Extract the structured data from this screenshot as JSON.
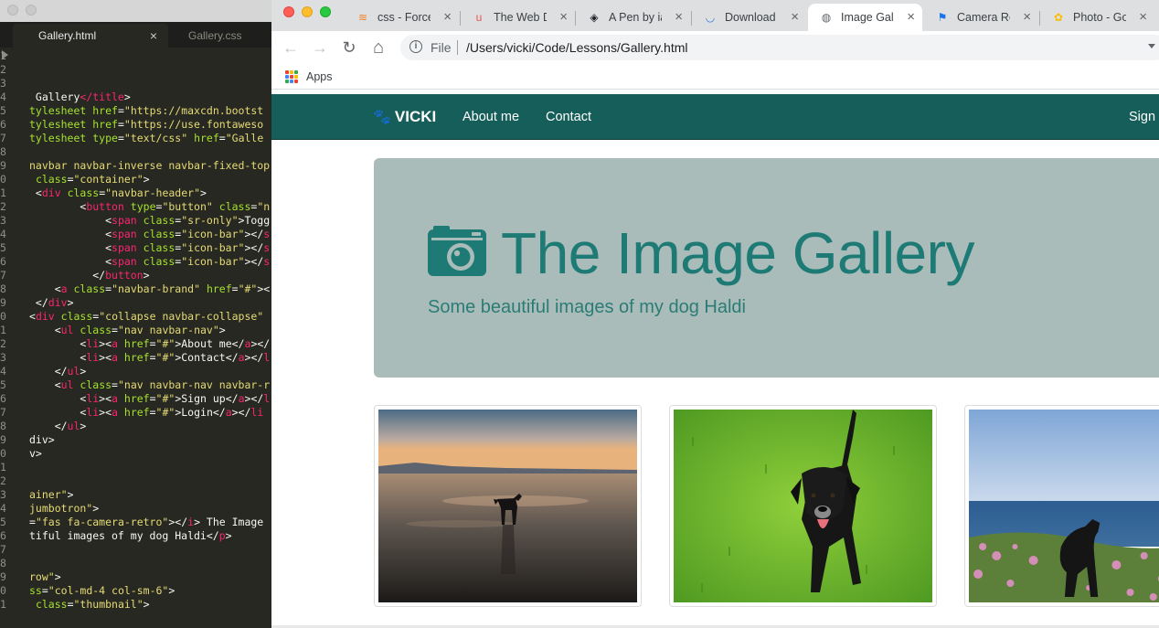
{
  "editor": {
    "tabs": [
      {
        "label": "Gallery.html",
        "active": true
      },
      {
        "label": "Gallery.css",
        "active": false
      }
    ],
    "close_glyph": "×",
    "lines": [
      {
        "n": "1",
        "parts": []
      },
      {
        "n": "2",
        "parts": []
      },
      {
        "n": "3",
        "parts": []
      },
      {
        "n": "4",
        "parts": [
          [
            "w",
            " Gallery"
          ],
          [
            "t",
            "</title"
          ],
          [
            "w",
            ">"
          ]
        ]
      },
      {
        "n": "5",
        "parts": [
          [
            "a",
            "tylesheet"
          ],
          [
            "w",
            " "
          ],
          [
            "a",
            "href"
          ],
          [
            "w",
            "="
          ],
          [
            "s",
            "\"https://maxcdn.bootst"
          ]
        ]
      },
      {
        "n": "6",
        "parts": [
          [
            "a",
            "tylesheet"
          ],
          [
            "w",
            " "
          ],
          [
            "a",
            "href"
          ],
          [
            "w",
            "="
          ],
          [
            "s",
            "\"https://use.fontaweso"
          ]
        ]
      },
      {
        "n": "7",
        "parts": [
          [
            "a",
            "tylesheet"
          ],
          [
            "w",
            " "
          ],
          [
            "a",
            "type"
          ],
          [
            "w",
            "="
          ],
          [
            "s",
            "\"text/css\""
          ],
          [
            "w",
            " "
          ],
          [
            "a",
            "href"
          ],
          [
            "w",
            "="
          ],
          [
            "s",
            "\"Galle"
          ]
        ]
      },
      {
        "n": "8",
        "parts": []
      },
      {
        "n": "9",
        "parts": [
          [
            "s",
            "navbar navbar-inverse navbar-fixed-top"
          ]
        ]
      },
      {
        "n": "0",
        "parts": [
          [
            "w",
            " "
          ],
          [
            "a",
            "class"
          ],
          [
            "w",
            "="
          ],
          [
            "s",
            "\"container\""
          ],
          [
            "w",
            ">"
          ]
        ]
      },
      {
        "n": "1",
        "parts": [
          [
            "w",
            " <"
          ],
          [
            "t",
            "div"
          ],
          [
            "w",
            " "
          ],
          [
            "a",
            "class"
          ],
          [
            "w",
            "="
          ],
          [
            "s",
            "\"navbar-header\""
          ],
          [
            "w",
            ">"
          ]
        ]
      },
      {
        "n": "2",
        "parts": [
          [
            "w",
            "        <"
          ],
          [
            "t",
            "button"
          ],
          [
            "w",
            " "
          ],
          [
            "a",
            "type"
          ],
          [
            "w",
            "="
          ],
          [
            "s",
            "\"button\""
          ],
          [
            "w",
            " "
          ],
          [
            "a",
            "class"
          ],
          [
            "w",
            "="
          ],
          [
            "s",
            "\"n"
          ]
        ]
      },
      {
        "n": "3",
        "parts": [
          [
            "w",
            "            <"
          ],
          [
            "t",
            "span"
          ],
          [
            "w",
            " "
          ],
          [
            "a",
            "class"
          ],
          [
            "w",
            "="
          ],
          [
            "s",
            "\"sr-only\""
          ],
          [
            "w",
            ">Togg"
          ]
        ]
      },
      {
        "n": "4",
        "parts": [
          [
            "w",
            "            <"
          ],
          [
            "t",
            "span"
          ],
          [
            "w",
            " "
          ],
          [
            "a",
            "class"
          ],
          [
            "w",
            "="
          ],
          [
            "s",
            "\"icon-bar\""
          ],
          [
            "w",
            "></"
          ],
          [
            "t",
            "s"
          ]
        ]
      },
      {
        "n": "5",
        "parts": [
          [
            "w",
            "            <"
          ],
          [
            "t",
            "span"
          ],
          [
            "w",
            " "
          ],
          [
            "a",
            "class"
          ],
          [
            "w",
            "="
          ],
          [
            "s",
            "\"icon-bar\""
          ],
          [
            "w",
            "></"
          ],
          [
            "t",
            "s"
          ]
        ]
      },
      {
        "n": "6",
        "parts": [
          [
            "w",
            "            <"
          ],
          [
            "t",
            "span"
          ],
          [
            "w",
            " "
          ],
          [
            "a",
            "class"
          ],
          [
            "w",
            "="
          ],
          [
            "s",
            "\"icon-bar\""
          ],
          [
            "w",
            "></"
          ],
          [
            "t",
            "s"
          ]
        ]
      },
      {
        "n": "7",
        "parts": [
          [
            "w",
            "          </"
          ],
          [
            "t",
            "button"
          ],
          [
            "w",
            ">"
          ]
        ]
      },
      {
        "n": "8",
        "parts": [
          [
            "w",
            "    <"
          ],
          [
            "t",
            "a"
          ],
          [
            "w",
            " "
          ],
          [
            "a",
            "class"
          ],
          [
            "w",
            "="
          ],
          [
            "s",
            "\"navbar-brand\""
          ],
          [
            "w",
            " "
          ],
          [
            "a",
            "href"
          ],
          [
            "w",
            "="
          ],
          [
            "s",
            "\"#\""
          ],
          [
            "w",
            "><"
          ]
        ]
      },
      {
        "n": "9",
        "parts": [
          [
            "w",
            " </"
          ],
          [
            "t",
            "div"
          ],
          [
            "w",
            ">"
          ]
        ]
      },
      {
        "n": "0",
        "parts": [
          [
            "w",
            "<"
          ],
          [
            "t",
            "div"
          ],
          [
            "w",
            " "
          ],
          [
            "a",
            "class"
          ],
          [
            "w",
            "="
          ],
          [
            "s",
            "\"collapse navbar-collapse\""
          ]
        ]
      },
      {
        "n": "1",
        "parts": [
          [
            "w",
            "    <"
          ],
          [
            "t",
            "ul"
          ],
          [
            "w",
            " "
          ],
          [
            "a",
            "class"
          ],
          [
            "w",
            "="
          ],
          [
            "s",
            "\"nav navbar-nav\""
          ],
          [
            "w",
            ">"
          ]
        ]
      },
      {
        "n": "2",
        "parts": [
          [
            "w",
            "        <"
          ],
          [
            "t",
            "li"
          ],
          [
            "w",
            "><"
          ],
          [
            "t",
            "a"
          ],
          [
            "w",
            " "
          ],
          [
            "a",
            "href"
          ],
          [
            "w",
            "="
          ],
          [
            "s",
            "\"#\""
          ],
          [
            "w",
            ">About me</"
          ],
          [
            "t",
            "a"
          ],
          [
            "w",
            "></"
          ]
        ]
      },
      {
        "n": "3",
        "parts": [
          [
            "w",
            "        <"
          ],
          [
            "t",
            "li"
          ],
          [
            "w",
            "><"
          ],
          [
            "t",
            "a"
          ],
          [
            "w",
            " "
          ],
          [
            "a",
            "href"
          ],
          [
            "w",
            "="
          ],
          [
            "s",
            "\"#\""
          ],
          [
            "w",
            ">Contact</"
          ],
          [
            "t",
            "a"
          ],
          [
            "w",
            "></"
          ],
          [
            "t",
            "l"
          ]
        ]
      },
      {
        "n": "4",
        "parts": [
          [
            "w",
            "    </"
          ],
          [
            "t",
            "ul"
          ],
          [
            "w",
            ">"
          ]
        ]
      },
      {
        "n": "5",
        "parts": [
          [
            "w",
            "    <"
          ],
          [
            "t",
            "ul"
          ],
          [
            "w",
            " "
          ],
          [
            "a",
            "class"
          ],
          [
            "w",
            "="
          ],
          [
            "s",
            "\"nav navbar-nav navbar-r"
          ]
        ]
      },
      {
        "n": "6",
        "parts": [
          [
            "w",
            "        <"
          ],
          [
            "t",
            "li"
          ],
          [
            "w",
            "><"
          ],
          [
            "t",
            "a"
          ],
          [
            "w",
            " "
          ],
          [
            "a",
            "href"
          ],
          [
            "w",
            "="
          ],
          [
            "s",
            "\"#\""
          ],
          [
            "w",
            ">Sign up</"
          ],
          [
            "t",
            "a"
          ],
          [
            "w",
            "></"
          ],
          [
            "t",
            "l"
          ]
        ]
      },
      {
        "n": "7",
        "parts": [
          [
            "w",
            "        <"
          ],
          [
            "t",
            "li"
          ],
          [
            "w",
            "><"
          ],
          [
            "t",
            "a"
          ],
          [
            "w",
            " "
          ],
          [
            "a",
            "href"
          ],
          [
            "w",
            "="
          ],
          [
            "s",
            "\"#\""
          ],
          [
            "w",
            ">Login</"
          ],
          [
            "t",
            "a"
          ],
          [
            "w",
            "></"
          ],
          [
            "t",
            "li"
          ]
        ]
      },
      {
        "n": "8",
        "parts": [
          [
            "w",
            "    </"
          ],
          [
            "t",
            "ul"
          ],
          [
            "w",
            ">"
          ]
        ]
      },
      {
        "n": "9",
        "parts": [
          [
            "w",
            "div>"
          ]
        ]
      },
      {
        "n": "0",
        "parts": [
          [
            "w",
            "v>"
          ]
        ]
      },
      {
        "n": "1",
        "parts": []
      },
      {
        "n": "2",
        "parts": []
      },
      {
        "n": "3",
        "parts": [
          [
            "s",
            "ainer\""
          ],
          [
            "w",
            ">"
          ]
        ]
      },
      {
        "n": "4",
        "parts": [
          [
            "s",
            "jumbotron\""
          ],
          [
            "w",
            ">"
          ]
        ]
      },
      {
        "n": "5",
        "parts": [
          [
            "w",
            "="
          ],
          [
            "s",
            "\"fas fa-camera-retro\""
          ],
          [
            "w",
            "></"
          ],
          [
            "t",
            "i"
          ],
          [
            "w",
            "> The Image"
          ]
        ]
      },
      {
        "n": "6",
        "parts": [
          [
            "w",
            "tiful images of my dog Haldi</"
          ],
          [
            "t",
            "p"
          ],
          [
            "w",
            ">"
          ]
        ]
      },
      {
        "n": "7",
        "parts": []
      },
      {
        "n": "8",
        "parts": []
      },
      {
        "n": "9",
        "parts": [
          [
            "s",
            "row\""
          ],
          [
            "w",
            ">"
          ]
        ]
      },
      {
        "n": "0",
        "parts": [
          [
            "a",
            "ss"
          ],
          [
            "w",
            "="
          ],
          [
            "s",
            "\"col-md-4 col-sm-6\""
          ],
          [
            "w",
            ">"
          ]
        ]
      },
      {
        "n": "1",
        "parts": [
          [
            "w",
            " "
          ],
          [
            "a",
            "class"
          ],
          [
            "w",
            "="
          ],
          [
            "s",
            "\"thumbnail\""
          ],
          [
            "w",
            ">"
          ]
        ]
      }
    ]
  },
  "browser": {
    "tabs": [
      {
        "label": "css - Force",
        "favicon": "stack-overflow-icon",
        "glyph": "≋",
        "fav_color": "#f48024"
      },
      {
        "label": "The Web D",
        "favicon": "udemy-icon",
        "glyph": "u",
        "fav_color": "#ec5252"
      },
      {
        "label": "A Pen by ia",
        "favicon": "codepen-icon",
        "glyph": "◈",
        "fav_color": "#1e1f26"
      },
      {
        "label": "Download",
        "favicon": "download-site-icon",
        "glyph": "◡",
        "fav_color": "#2d7bd6"
      },
      {
        "label": "Image Galle",
        "favicon": "globe-icon",
        "glyph": "◍",
        "fav_color": "#5f6368",
        "active": true
      },
      {
        "label": "Camera Re",
        "favicon": "flag-icon",
        "glyph": "⚑",
        "fav_color": "#1a73e8"
      },
      {
        "label": "Photo - Go",
        "favicon": "google-photos-icon",
        "glyph": "✿",
        "fav_color": "#fbbc04"
      }
    ],
    "close_glyph": "×",
    "toolbar": {
      "back_glyph": "←",
      "forward_glyph": "→",
      "reload_glyph": "↻",
      "home_glyph": "⌂",
      "info_glyph": "i",
      "scheme_label": "File",
      "url": "/Users/vicki/Code/Lessons/Gallery.html"
    },
    "bookmarks": {
      "apps_label": "Apps",
      "apps_colors": [
        "#ea4335",
        "#fbbc04",
        "#34a853",
        "#4285f4",
        "#ea4335",
        "#fbbc04",
        "#34a853",
        "#4285f4",
        "#ea4335"
      ]
    }
  },
  "page": {
    "navbar": {
      "brand": "VICKI",
      "brand_glyph": "🐾",
      "links": [
        "About me",
        "Contact"
      ],
      "right_link": "Sign",
      "bg": "#155e5a"
    },
    "jumbotron": {
      "title": "The Image Gallery",
      "subtitle": "Some beautiful images of my dog Haldi",
      "bg": "#aabcb9",
      "accent": "#1d7a74"
    },
    "thumbnails": [
      {
        "subject": "dog on beach at sunset"
      },
      {
        "subject": "dog on grass"
      },
      {
        "subject": "dog on cliff by sea"
      }
    ]
  }
}
